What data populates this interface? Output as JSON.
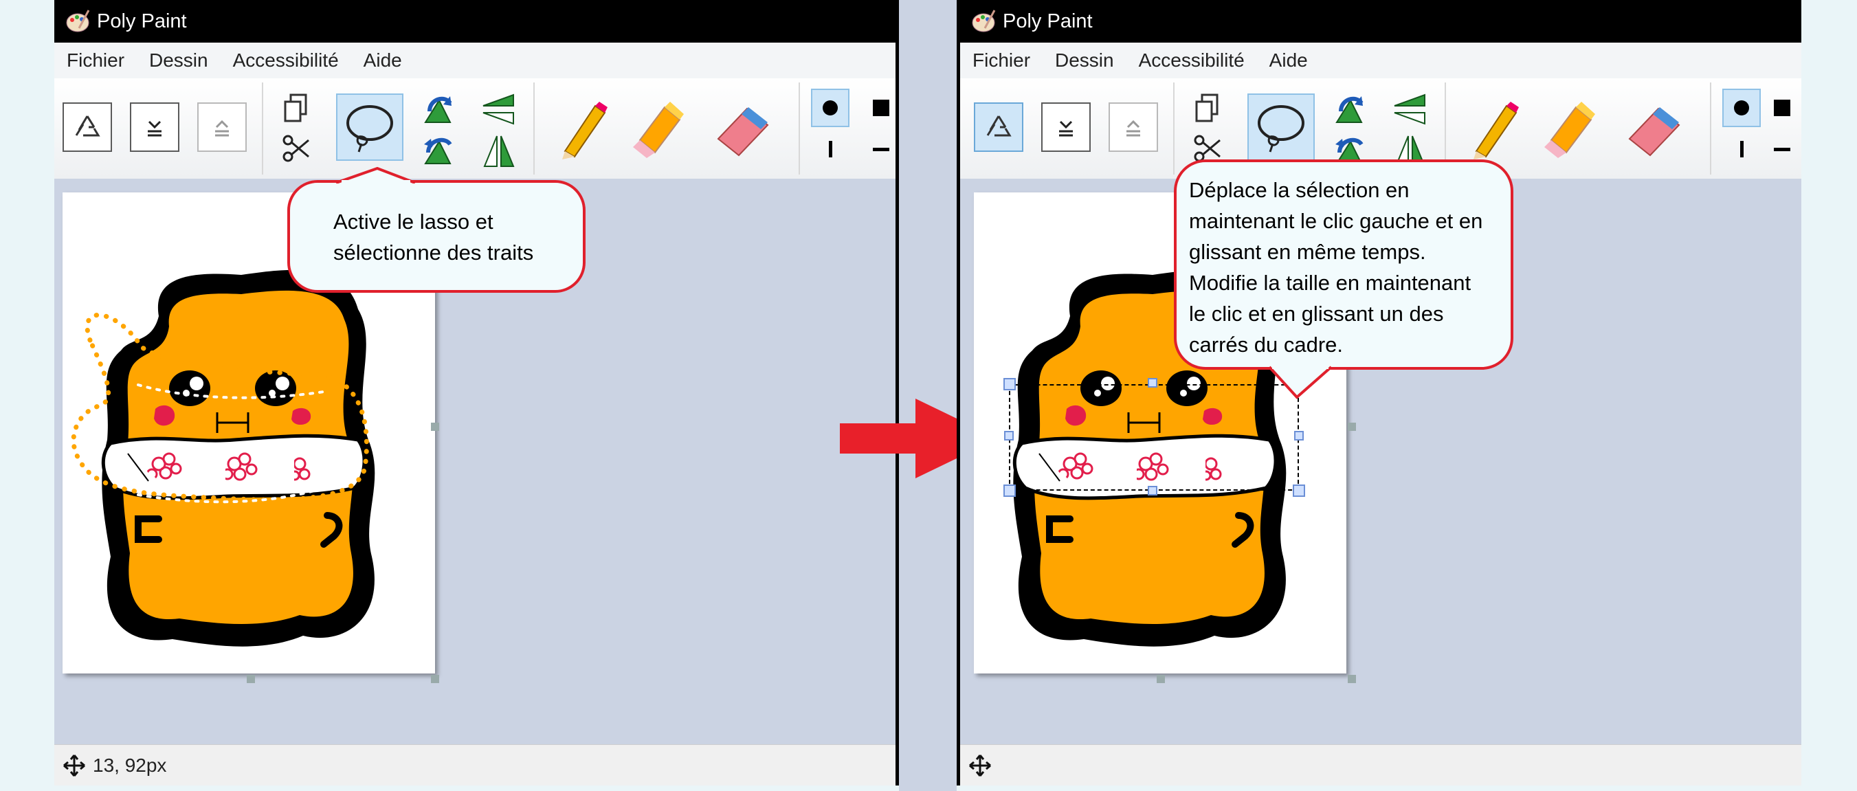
{
  "app": {
    "title": "Poly Paint"
  },
  "menu": [
    "Fichier",
    "Dessin",
    "Accessibilité",
    "Aide"
  ],
  "toolbar": {
    "tools": [
      "recycle-icon",
      "flip-down-icon",
      "flip-up-icon",
      "copy-icon",
      "cut-icon",
      "lasso-icon",
      "rotate-left-icon",
      "rotate-right-icon",
      "mirror-horizontal-icon",
      "mirror-vertical-icon",
      "pencil-icon",
      "marker-icon",
      "eraser-icon",
      "round-tip-icon",
      "square-tip-icon",
      "vertical-tip-icon",
      "horizontal-tip-icon"
    ],
    "active_tool": "lasso"
  },
  "left_panel": {
    "status_text": "13, 92px",
    "callout": "Active le lasso et\nsélectionne des traits"
  },
  "right_panel": {
    "status_text": "",
    "callout": "Déplace la sélection en\nmaintenant le clic gauche et en\nglissant en même temps.\nModifie la taille en maintenant\nle clic et en glissant un des\ncarrés du cadre."
  },
  "colors": {
    "bubble_border": "#e0202c",
    "arrow": "#e8202a",
    "selection_accent": "#cfe6f8",
    "canvas_background": "#cbd3e3",
    "drawing_body": "#ffa500"
  }
}
